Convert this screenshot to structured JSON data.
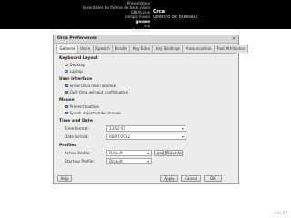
{
  "nav": {
    "left_items": [
      "Presentation",
      "Essentiales de formes de base vision",
      "GNU/Linux",
      "compiz fusion",
      "gnome",
      "vlui",
      "Questions"
    ],
    "active_left_index": 4,
    "section": "Orca",
    "subsection": "Ubérico de bureaux"
  },
  "dialog": {
    "title": "Orca Preferences",
    "close_glyph": "✕",
    "tabs": [
      "General",
      "Voice",
      "Speech",
      "Braille",
      "Key Echo",
      "Key Bindings",
      "Pronunciation",
      "Text Attributes"
    ],
    "selected_tab": 0,
    "sections": {
      "keyboard_layout": "Keyboard Layout",
      "user_interface": "User Interface",
      "mouse": "Mouse",
      "time_date": "Time and Date",
      "profiles": "Profiles"
    },
    "keyboard_options": [
      {
        "label": "Desktop",
        "selected": false
      },
      {
        "label": "Laptop",
        "selected": true
      }
    ],
    "ui_options": [
      {
        "label": "Show Orca main window",
        "checked": true
      },
      {
        "label": "Quit Orca without confirmation",
        "checked": true
      }
    ],
    "mouse_options": [
      {
        "label": "Present tooltips",
        "checked": true
      },
      {
        "label": "Speak object under mouse",
        "checked": true
      }
    ],
    "time_format_label": "Time format:",
    "time_format_value": "23:52:07",
    "date_format_label": "Date format:",
    "date_format_value": "08/07/2012",
    "active_profile_label": "Active Profile:",
    "active_profile_value": "Default",
    "load_label": "Load",
    "save_as_label": "Save As",
    "startup_profile_label": "Start-up Profile:",
    "startup_profile_value": "Default",
    "help_label": "Help",
    "apply_label": "Apply",
    "cancel_label": "Cancel",
    "ok_label": "OK",
    "dropdown_glyph": "▾"
  },
  "page_number": "24 / 27"
}
